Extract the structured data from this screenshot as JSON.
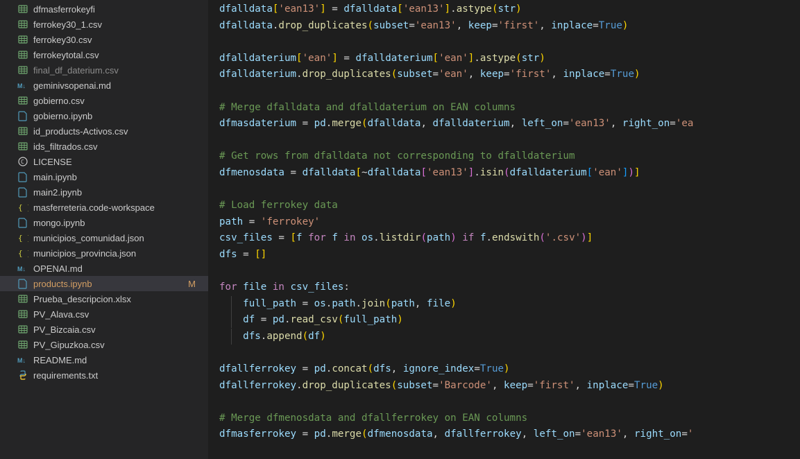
{
  "sidebar": {
    "files": [
      {
        "name": "dfmasferrokeyfi",
        "icon": "csv",
        "dimmed": false,
        "status": ""
      },
      {
        "name": "ferrokey30_1.csv",
        "icon": "csv",
        "dimmed": false,
        "status": ""
      },
      {
        "name": "ferrokey30.csv",
        "icon": "csv",
        "dimmed": false,
        "status": ""
      },
      {
        "name": "ferrokeytotal.csv",
        "icon": "csv",
        "dimmed": false,
        "status": ""
      },
      {
        "name": "final_df_daterium.csv",
        "icon": "csv",
        "dimmed": true,
        "status": ""
      },
      {
        "name": "geminivsopenai.md",
        "icon": "md",
        "dimmed": false,
        "status": ""
      },
      {
        "name": "gobierno.csv",
        "icon": "csv",
        "dimmed": false,
        "status": ""
      },
      {
        "name": "gobierno.ipynb",
        "icon": "ipynb",
        "dimmed": false,
        "status": ""
      },
      {
        "name": "id_products-Activos.csv",
        "icon": "csv",
        "dimmed": false,
        "status": ""
      },
      {
        "name": "ids_filtrados.csv",
        "icon": "csv",
        "dimmed": false,
        "status": ""
      },
      {
        "name": "LICENSE",
        "icon": "license",
        "dimmed": false,
        "status": ""
      },
      {
        "name": "main.ipynb",
        "icon": "ipynb",
        "dimmed": false,
        "status": ""
      },
      {
        "name": "main2.ipynb",
        "icon": "ipynb",
        "dimmed": false,
        "status": ""
      },
      {
        "name": "masferreteria.code-workspace",
        "icon": "json",
        "dimmed": false,
        "status": ""
      },
      {
        "name": "mongo.ipynb",
        "icon": "ipynb",
        "dimmed": false,
        "status": ""
      },
      {
        "name": "municipios_comunidad.json",
        "icon": "json",
        "dimmed": false,
        "status": ""
      },
      {
        "name": "municipios_provincia.json",
        "icon": "json",
        "dimmed": false,
        "status": ""
      },
      {
        "name": "OPENAI.md",
        "icon": "md",
        "dimmed": false,
        "status": ""
      },
      {
        "name": "products.ipynb",
        "icon": "ipynb",
        "dimmed": false,
        "status": "M",
        "active": true,
        "modified": true
      },
      {
        "name": "Prueba_descripcion.xlsx",
        "icon": "xlsx",
        "dimmed": false,
        "status": ""
      },
      {
        "name": "PV_Alava.csv",
        "icon": "csv",
        "dimmed": false,
        "status": ""
      },
      {
        "name": "PV_Bizcaia.csv",
        "icon": "csv",
        "dimmed": false,
        "status": ""
      },
      {
        "name": "PV_Gipuzkoa.csv",
        "icon": "csv",
        "dimmed": false,
        "status": ""
      },
      {
        "name": "README.md",
        "icon": "md",
        "dimmed": false,
        "status": ""
      },
      {
        "name": "requirements.txt",
        "icon": "py",
        "dimmed": false,
        "status": ""
      }
    ]
  },
  "code": {
    "lines": [
      {
        "type": "code",
        "tokens": [
          [
            "var",
            "dfalldata"
          ],
          [
            "bracket1",
            "["
          ],
          [
            "str",
            "'ean13'"
          ],
          [
            "bracket1",
            "]"
          ],
          [
            "op",
            " = "
          ],
          [
            "var",
            "dfalldata"
          ],
          [
            "bracket1",
            "["
          ],
          [
            "str",
            "'ean13'"
          ],
          [
            "bracket1",
            "]"
          ],
          [
            "punct",
            "."
          ],
          [
            "func",
            "astype"
          ],
          [
            "bracket1",
            "("
          ],
          [
            "obj",
            "str"
          ],
          [
            "bracket1",
            ")"
          ]
        ]
      },
      {
        "type": "code",
        "tokens": [
          [
            "var",
            "dfalldata"
          ],
          [
            "punct",
            "."
          ],
          [
            "func",
            "drop_duplicates"
          ],
          [
            "bracket1",
            "("
          ],
          [
            "var",
            "subset"
          ],
          [
            "op",
            "="
          ],
          [
            "str",
            "'ean13'"
          ],
          [
            "punct",
            ", "
          ],
          [
            "var",
            "keep"
          ],
          [
            "op",
            "="
          ],
          [
            "str",
            "'first'"
          ],
          [
            "punct",
            ", "
          ],
          [
            "var",
            "inplace"
          ],
          [
            "op",
            "="
          ],
          [
            "const",
            "True"
          ],
          [
            "bracket1",
            ")"
          ]
        ]
      },
      {
        "type": "blank"
      },
      {
        "type": "code",
        "tokens": [
          [
            "var",
            "dfalldaterium"
          ],
          [
            "bracket1",
            "["
          ],
          [
            "str",
            "'ean'"
          ],
          [
            "bracket1",
            "]"
          ],
          [
            "op",
            " = "
          ],
          [
            "var",
            "dfalldaterium"
          ],
          [
            "bracket1",
            "["
          ],
          [
            "str",
            "'ean'"
          ],
          [
            "bracket1",
            "]"
          ],
          [
            "punct",
            "."
          ],
          [
            "func",
            "astype"
          ],
          [
            "bracket1",
            "("
          ],
          [
            "obj",
            "str"
          ],
          [
            "bracket1",
            ")"
          ]
        ]
      },
      {
        "type": "code",
        "tokens": [
          [
            "var",
            "dfalldaterium"
          ],
          [
            "punct",
            "."
          ],
          [
            "func",
            "drop_duplicates"
          ],
          [
            "bracket1",
            "("
          ],
          [
            "var",
            "subset"
          ],
          [
            "op",
            "="
          ],
          [
            "str",
            "'ean'"
          ],
          [
            "punct",
            ", "
          ],
          [
            "var",
            "keep"
          ],
          [
            "op",
            "="
          ],
          [
            "str",
            "'first'"
          ],
          [
            "punct",
            ", "
          ],
          [
            "var",
            "inplace"
          ],
          [
            "op",
            "="
          ],
          [
            "const",
            "True"
          ],
          [
            "bracket1",
            ")"
          ]
        ]
      },
      {
        "type": "blank"
      },
      {
        "type": "comment",
        "text": "# Merge dfalldata and dfalldaterium on EAN columns"
      },
      {
        "type": "code",
        "tokens": [
          [
            "var",
            "dfmasdaterium"
          ],
          [
            "op",
            " = "
          ],
          [
            "var",
            "pd"
          ],
          [
            "punct",
            "."
          ],
          [
            "func",
            "merge"
          ],
          [
            "bracket1",
            "("
          ],
          [
            "var",
            "dfalldata"
          ],
          [
            "punct",
            ", "
          ],
          [
            "var",
            "dfalldaterium"
          ],
          [
            "punct",
            ", "
          ],
          [
            "var",
            "left_on"
          ],
          [
            "op",
            "="
          ],
          [
            "str",
            "'ean13'"
          ],
          [
            "punct",
            ", "
          ],
          [
            "var",
            "right_on"
          ],
          [
            "op",
            "="
          ],
          [
            "str",
            "'ea"
          ]
        ]
      },
      {
        "type": "blank"
      },
      {
        "type": "comment",
        "text": "# Get rows from dfalldata not corresponding to dfalldaterium"
      },
      {
        "type": "code",
        "tokens": [
          [
            "var",
            "dfmenosdata"
          ],
          [
            "op",
            " = "
          ],
          [
            "var",
            "dfalldata"
          ],
          [
            "bracket1",
            "["
          ],
          [
            "op",
            "~"
          ],
          [
            "var",
            "dfalldata"
          ],
          [
            "bracket2",
            "["
          ],
          [
            "str",
            "'ean13'"
          ],
          [
            "bracket2",
            "]"
          ],
          [
            "punct",
            "."
          ],
          [
            "func",
            "isin"
          ],
          [
            "bracket2",
            "("
          ],
          [
            "var",
            "dfalldaterium"
          ],
          [
            "bracket3",
            "["
          ],
          [
            "str",
            "'ean'"
          ],
          [
            "bracket3",
            "]"
          ],
          [
            "bracket2",
            ")"
          ],
          [
            "bracket1",
            "]"
          ]
        ]
      },
      {
        "type": "blank"
      },
      {
        "type": "comment",
        "text": "# Load ferrokey data"
      },
      {
        "type": "code",
        "tokens": [
          [
            "var",
            "path"
          ],
          [
            "op",
            " = "
          ],
          [
            "str",
            "'ferrokey'"
          ]
        ]
      },
      {
        "type": "code",
        "tokens": [
          [
            "var",
            "csv_files"
          ],
          [
            "op",
            " = "
          ],
          [
            "bracket1",
            "["
          ],
          [
            "var",
            "f"
          ],
          [
            "op",
            " "
          ],
          [
            "kw2",
            "for"
          ],
          [
            "op",
            " "
          ],
          [
            "var",
            "f"
          ],
          [
            "op",
            " "
          ],
          [
            "kw2",
            "in"
          ],
          [
            "op",
            " "
          ],
          [
            "var",
            "os"
          ],
          [
            "punct",
            "."
          ],
          [
            "func",
            "listdir"
          ],
          [
            "bracket2",
            "("
          ],
          [
            "var",
            "path"
          ],
          [
            "bracket2",
            ")"
          ],
          [
            "op",
            " "
          ],
          [
            "kw2",
            "if"
          ],
          [
            "op",
            " "
          ],
          [
            "var",
            "f"
          ],
          [
            "punct",
            "."
          ],
          [
            "func",
            "endswith"
          ],
          [
            "bracket2",
            "("
          ],
          [
            "str",
            "'.csv'"
          ],
          [
            "bracket2",
            ")"
          ],
          [
            "bracket1",
            "]"
          ]
        ]
      },
      {
        "type": "code",
        "tokens": [
          [
            "var",
            "dfs"
          ],
          [
            "op",
            " = "
          ],
          [
            "bracket1",
            "["
          ],
          [
            "bracket1",
            "]"
          ]
        ]
      },
      {
        "type": "blank"
      },
      {
        "type": "code",
        "tokens": [
          [
            "kw2",
            "for"
          ],
          [
            "op",
            " "
          ],
          [
            "var",
            "file"
          ],
          [
            "op",
            " "
          ],
          [
            "kw2",
            "in"
          ],
          [
            "op",
            " "
          ],
          [
            "var",
            "csv_files"
          ],
          [
            "punct",
            ":"
          ]
        ]
      },
      {
        "type": "code",
        "indent": 1,
        "tokens": [
          [
            "var",
            "full_path"
          ],
          [
            "op",
            " = "
          ],
          [
            "var",
            "os"
          ],
          [
            "punct",
            "."
          ],
          [
            "var",
            "path"
          ],
          [
            "punct",
            "."
          ],
          [
            "func",
            "join"
          ],
          [
            "bracket1",
            "("
          ],
          [
            "var",
            "path"
          ],
          [
            "punct",
            ", "
          ],
          [
            "var",
            "file"
          ],
          [
            "bracket1",
            ")"
          ]
        ]
      },
      {
        "type": "code",
        "indent": 1,
        "tokens": [
          [
            "var",
            "df"
          ],
          [
            "op",
            " = "
          ],
          [
            "var",
            "pd"
          ],
          [
            "punct",
            "."
          ],
          [
            "func",
            "read_csv"
          ],
          [
            "bracket1",
            "("
          ],
          [
            "var",
            "full_path"
          ],
          [
            "bracket1",
            ")"
          ]
        ]
      },
      {
        "type": "code",
        "indent": 1,
        "tokens": [
          [
            "var",
            "dfs"
          ],
          [
            "punct",
            "."
          ],
          [
            "func",
            "append"
          ],
          [
            "bracket1",
            "("
          ],
          [
            "var",
            "df"
          ],
          [
            "bracket1",
            ")"
          ]
        ]
      },
      {
        "type": "blank"
      },
      {
        "type": "code",
        "tokens": [
          [
            "var",
            "dfallferrokey"
          ],
          [
            "op",
            " = "
          ],
          [
            "var",
            "pd"
          ],
          [
            "punct",
            "."
          ],
          [
            "func",
            "concat"
          ],
          [
            "bracket1",
            "("
          ],
          [
            "var",
            "dfs"
          ],
          [
            "punct",
            ", "
          ],
          [
            "var",
            "ignore_index"
          ],
          [
            "op",
            "="
          ],
          [
            "const",
            "True"
          ],
          [
            "bracket1",
            ")"
          ]
        ]
      },
      {
        "type": "code",
        "tokens": [
          [
            "var",
            "dfallferrokey"
          ],
          [
            "punct",
            "."
          ],
          [
            "func",
            "drop_duplicates"
          ],
          [
            "bracket1",
            "("
          ],
          [
            "var",
            "subset"
          ],
          [
            "op",
            "="
          ],
          [
            "str",
            "'Barcode'"
          ],
          [
            "punct",
            ", "
          ],
          [
            "var",
            "keep"
          ],
          [
            "op",
            "="
          ],
          [
            "str",
            "'first'"
          ],
          [
            "punct",
            ", "
          ],
          [
            "var",
            "inplace"
          ],
          [
            "op",
            "="
          ],
          [
            "const",
            "True"
          ],
          [
            "bracket1",
            ")"
          ]
        ]
      },
      {
        "type": "blank"
      },
      {
        "type": "comment",
        "text": "# Merge dfmenosdata and dfallferrokey on EAN columns"
      },
      {
        "type": "code",
        "tokens": [
          [
            "var",
            "dfmasferrokey"
          ],
          [
            "op",
            " = "
          ],
          [
            "var",
            "pd"
          ],
          [
            "punct",
            "."
          ],
          [
            "func",
            "merge"
          ],
          [
            "bracket1",
            "("
          ],
          [
            "var",
            "dfmenosdata"
          ],
          [
            "punct",
            ", "
          ],
          [
            "var",
            "dfallferrokey"
          ],
          [
            "punct",
            ", "
          ],
          [
            "var",
            "left_on"
          ],
          [
            "op",
            "="
          ],
          [
            "str",
            "'ean13'"
          ],
          [
            "punct",
            ", "
          ],
          [
            "var",
            "right_on"
          ],
          [
            "op",
            "="
          ],
          [
            "str",
            "'"
          ]
        ]
      }
    ]
  }
}
